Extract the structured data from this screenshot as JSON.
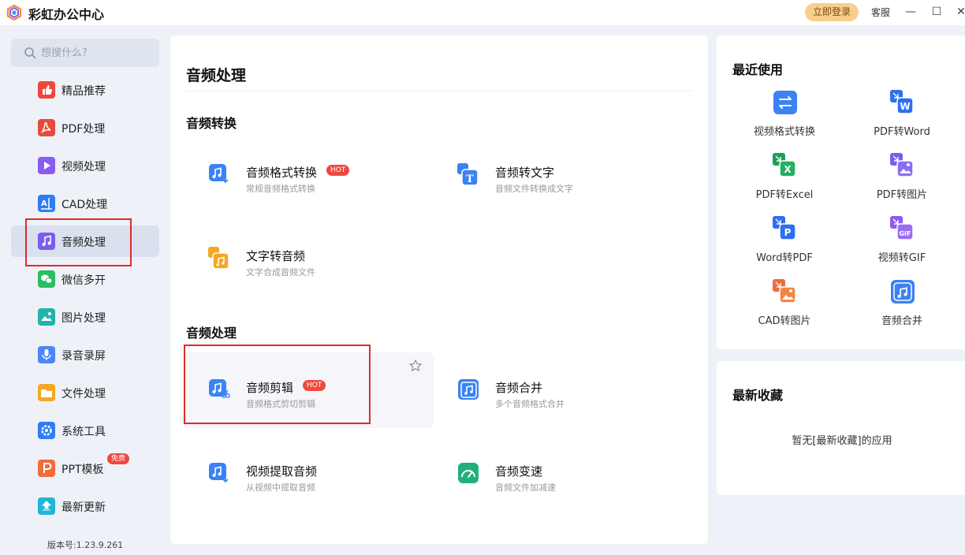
{
  "app": {
    "title": "彩虹办公中心",
    "login": "立即登录",
    "service": "客服",
    "minimize": "—",
    "maximize": "☐",
    "close": "✕"
  },
  "search": {
    "placeholder": "想搜什么?"
  },
  "sidebar": {
    "items": [
      {
        "label": "精品推荐",
        "color": "#f0473d"
      },
      {
        "label": "PDF处理",
        "color": "#e84b3c"
      },
      {
        "label": "视频处理",
        "color": "#8a5cf0"
      },
      {
        "label": "CAD处理",
        "color": "#2f7df5"
      },
      {
        "label": "音频处理",
        "color": "#7a5cf0",
        "active": true
      },
      {
        "label": "微信多开",
        "color": "#2bbd5f"
      },
      {
        "label": "图片处理",
        "color": "#22b2a8"
      },
      {
        "label": "录音录屏",
        "color": "#4a86f5"
      },
      {
        "label": "文件处理",
        "color": "#f5a623"
      },
      {
        "label": "系统工具",
        "color": "#2f7df5"
      },
      {
        "label": "PPT模板",
        "color": "#f26b3a",
        "badge": "免费"
      },
      {
        "label": "最新更新",
        "color": "#1fb5d8"
      }
    ],
    "version": "版本号:1.23.9.261"
  },
  "main": {
    "title": "音频处理",
    "sections": [
      {
        "title": "音频转换",
        "tools": [
          {
            "name": "音频格式转换",
            "desc": "常规音频格式转换",
            "hot": "HOT",
            "icon": "audio-convert-icon"
          },
          {
            "name": "音频转文字",
            "desc": "音频文件转换成文字",
            "icon": "audio-to-text-icon"
          },
          {
            "name": "文字转音频",
            "desc": "文字合成音频文件",
            "icon": "text-to-audio-icon"
          }
        ]
      },
      {
        "title": "音频处理",
        "tools": [
          {
            "name": "音频剪辑",
            "desc": "音频格式剪切剪辑",
            "hot": "HOT",
            "icon": "audio-cut-icon"
          },
          {
            "name": "音频合并",
            "desc": "多个音频格式合并",
            "icon": "audio-merge-icon"
          },
          {
            "name": "视频提取音频",
            "desc": "从视频中提取音频",
            "icon": "video-extract-audio-icon"
          },
          {
            "name": "音频变速",
            "desc": "音频文件加减速",
            "icon": "audio-speed-icon"
          }
        ]
      }
    ]
  },
  "recent": {
    "title": "最近使用",
    "items": [
      {
        "label": "视频格式转换"
      },
      {
        "label": "PDF转Word"
      },
      {
        "label": "PDF转Excel"
      },
      {
        "label": "PDF转图片"
      },
      {
        "label": "Word转PDF"
      },
      {
        "label": "视频转GIF"
      },
      {
        "label": "CAD转图片"
      },
      {
        "label": "音频合并"
      }
    ]
  },
  "favorites": {
    "title": "最新收藏",
    "empty": "暂无[最新收藏]的应用"
  }
}
